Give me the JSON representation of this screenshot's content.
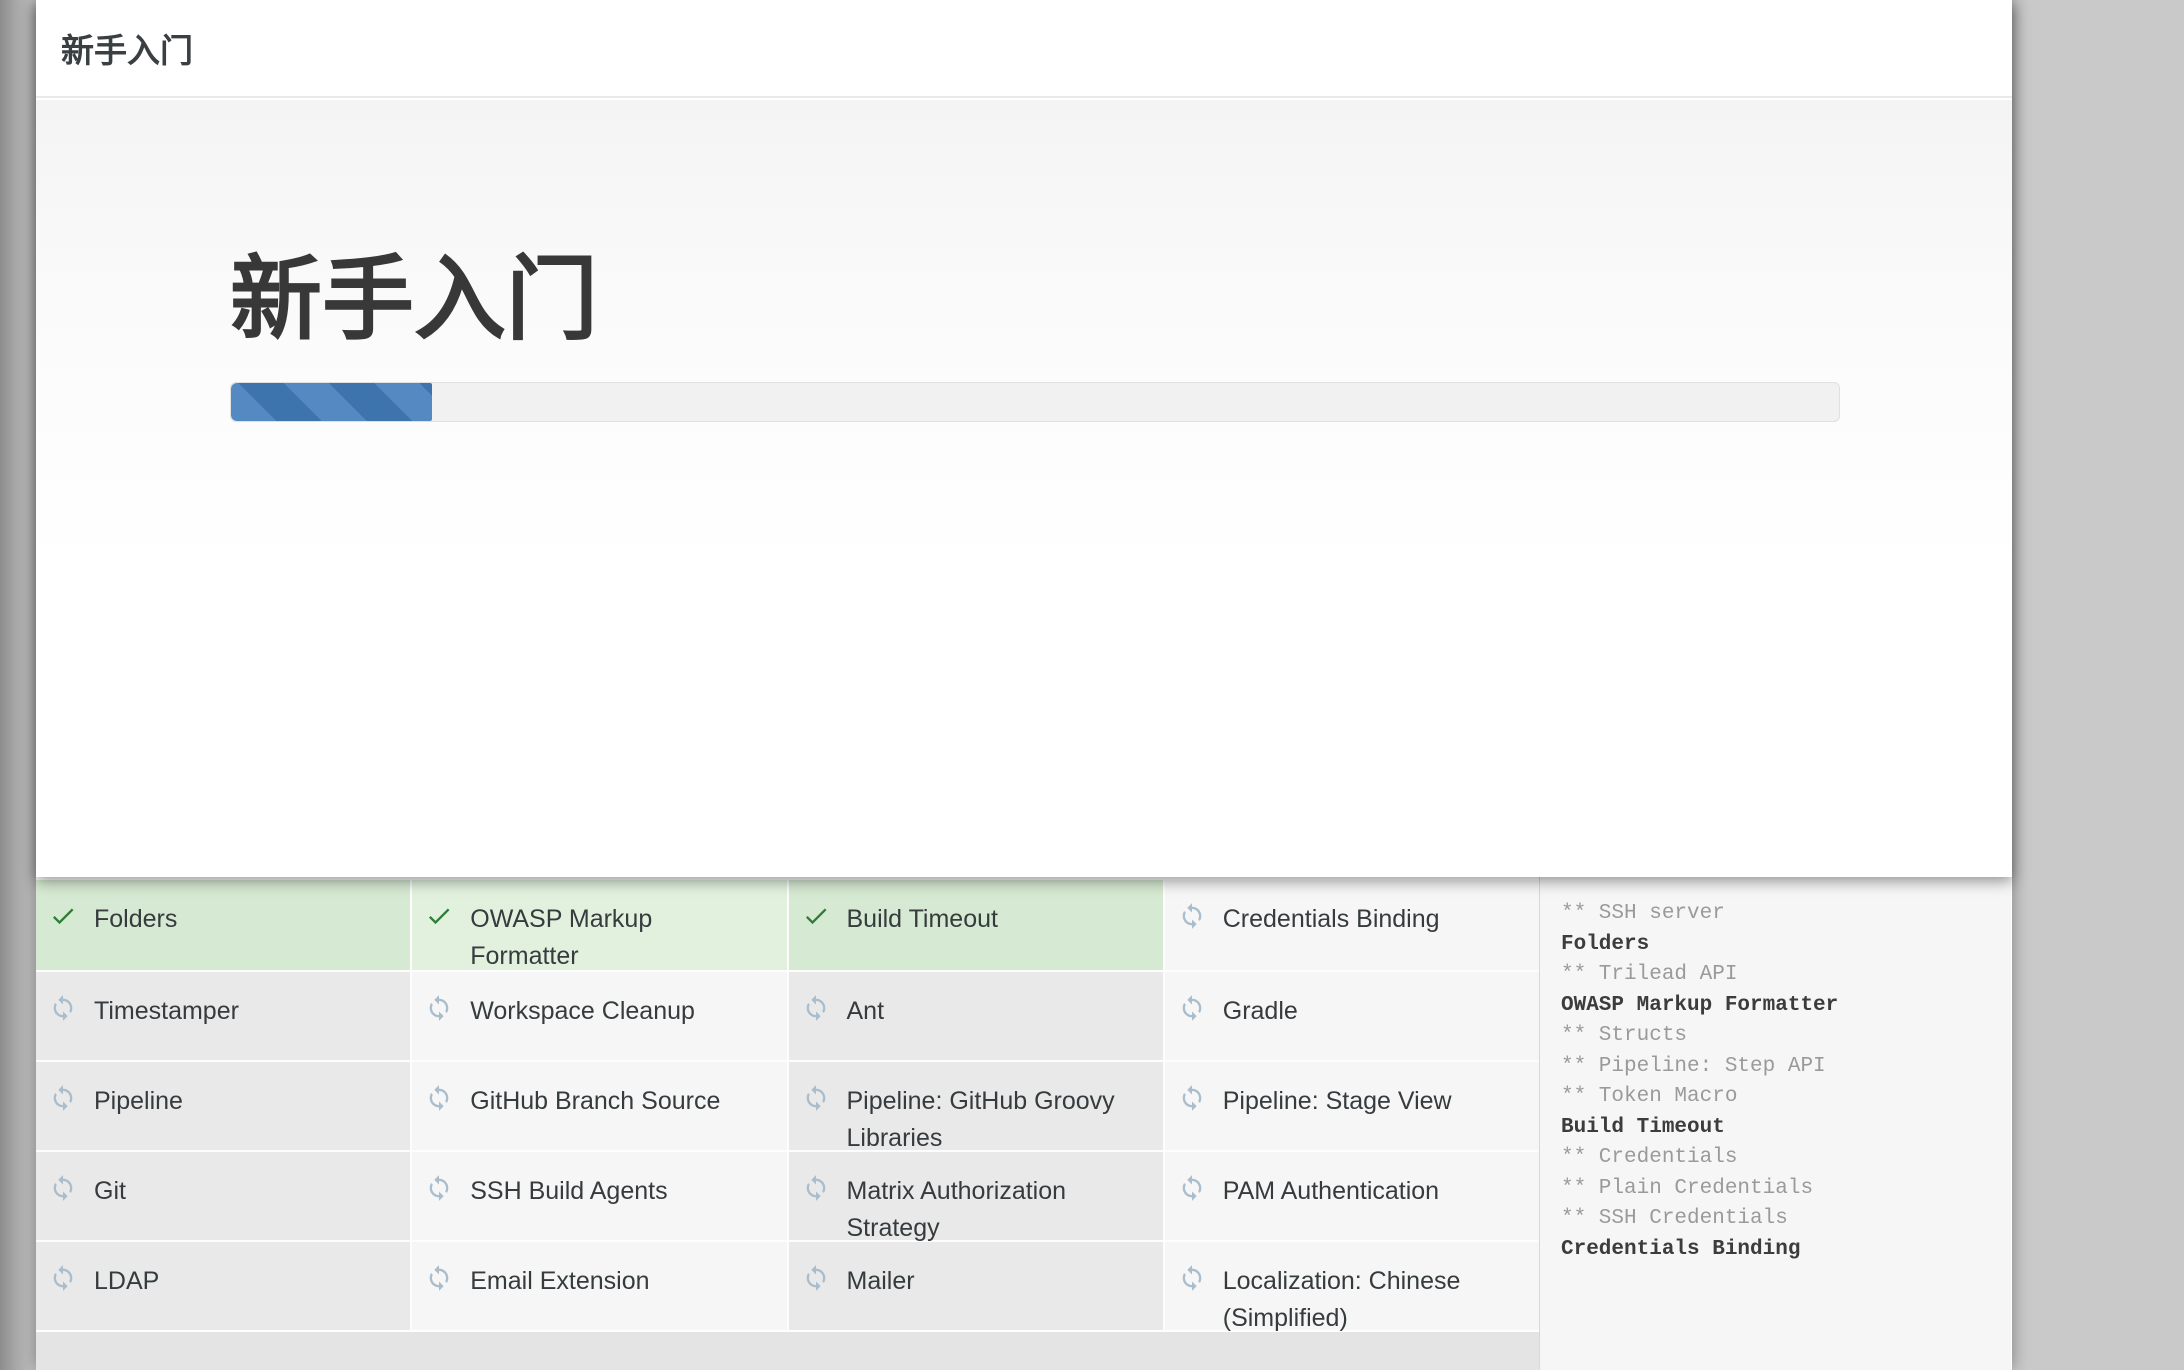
{
  "window": {
    "title": "新手入门"
  },
  "dialog": {
    "heading": "新手入门",
    "progress_percent": 12.5
  },
  "plugins": {
    "columns": 4,
    "items": [
      {
        "label": "Folders",
        "state": "done"
      },
      {
        "label": "OWASP Markup Formatter",
        "state": "done"
      },
      {
        "label": "Build Timeout",
        "state": "done"
      },
      {
        "label": "Credentials Binding",
        "state": "installing"
      },
      {
        "label": "Timestamper",
        "state": "pending"
      },
      {
        "label": "Workspace Cleanup",
        "state": "pending"
      },
      {
        "label": "Ant",
        "state": "pending"
      },
      {
        "label": "Gradle",
        "state": "pending"
      },
      {
        "label": "Pipeline",
        "state": "pending"
      },
      {
        "label": "GitHub Branch Source",
        "state": "pending"
      },
      {
        "label": "Pipeline: GitHub Groovy Libraries",
        "state": "pending"
      },
      {
        "label": "Pipeline: Stage View",
        "state": "pending"
      },
      {
        "label": "Git",
        "state": "pending"
      },
      {
        "label": "SSH Build Agents",
        "state": "pending"
      },
      {
        "label": "Matrix Authorization Strategy",
        "state": "pending"
      },
      {
        "label": "PAM Authentication",
        "state": "pending"
      },
      {
        "label": "LDAP",
        "state": "pending"
      },
      {
        "label": "Email Extension",
        "state": "pending"
      },
      {
        "label": "Mailer",
        "state": "pending"
      },
      {
        "label": "Localization: Chinese (Simplified)",
        "state": "pending"
      }
    ]
  },
  "log": {
    "lines": [
      {
        "text": "** SSH server",
        "emphasis": false
      },
      {
        "text": "Folders",
        "emphasis": true
      },
      {
        "text": "** Trilead API",
        "emphasis": false
      },
      {
        "text": "OWASP Markup Formatter",
        "emphasis": true
      },
      {
        "text": "** Structs",
        "emphasis": false
      },
      {
        "text": "** Pipeline: Step API",
        "emphasis": false
      },
      {
        "text": "** Token Macro",
        "emphasis": false
      },
      {
        "text": "Build Timeout",
        "emphasis": true
      },
      {
        "text": "** Credentials",
        "emphasis": false
      },
      {
        "text": "** Plain Credentials",
        "emphasis": false
      },
      {
        "text": "** SSH Credentials",
        "emphasis": false
      },
      {
        "text": "Credentials Binding",
        "emphasis": true
      }
    ]
  },
  "colors": {
    "accent_blue": "#3d74ae",
    "accent_blue_light": "#5589c1",
    "success_green": "#2e7d32",
    "success_bg_dark": "#d6e9d2",
    "success_bg_light": "#e2f1de",
    "pending_icon": "#a9bdcc",
    "cell_bg_dark": "#e9e9e9",
    "cell_bg_light": "#f6f6f6",
    "log_bg": "#f6f6f6",
    "body_bg": "#c9c9c9"
  }
}
